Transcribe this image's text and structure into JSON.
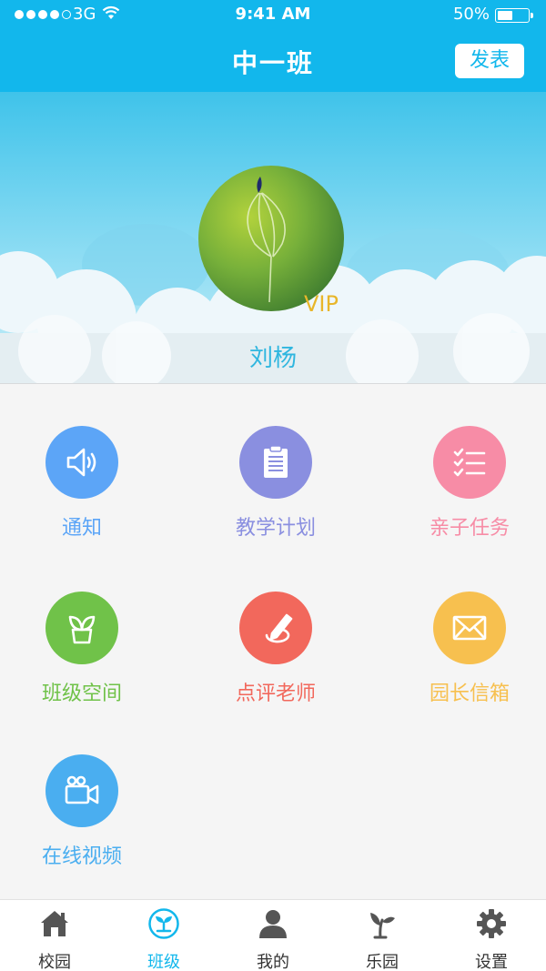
{
  "status_bar": {
    "carrier": "3G",
    "time": "9:41 AM",
    "battery": "50%"
  },
  "header": {
    "title": "中一班",
    "post_button": "发表"
  },
  "profile": {
    "name": "刘杨",
    "badge": "VIP"
  },
  "menu": [
    {
      "label": "通知",
      "icon": "speaker-icon",
      "color": "#5ca5f7"
    },
    {
      "label": "教学计划",
      "icon": "clipboard-icon",
      "color": "#8a8fe0"
    },
    {
      "label": "亲子任务",
      "icon": "checklist-icon",
      "color": "#f78ca6"
    },
    {
      "label": "班级空间",
      "icon": "plant-pot-icon",
      "color": "#70c249"
    },
    {
      "label": "点评老师",
      "icon": "pencil-icon",
      "color": "#f2685c"
    },
    {
      "label": "园长信箱",
      "icon": "envelope-icon",
      "color": "#f7c04f"
    },
    {
      "label": "在线视频",
      "icon": "video-camera-icon",
      "color": "#4aaef0"
    }
  ],
  "tabs": [
    {
      "label": "校园",
      "icon": "house-icon",
      "active": false
    },
    {
      "label": "班级",
      "icon": "sprout-circle-icon",
      "active": true
    },
    {
      "label": "我的",
      "icon": "person-icon",
      "active": false
    },
    {
      "label": "乐园",
      "icon": "sprout-icon",
      "active": false
    },
    {
      "label": "设置",
      "icon": "gear-icon",
      "active": false
    }
  ]
}
